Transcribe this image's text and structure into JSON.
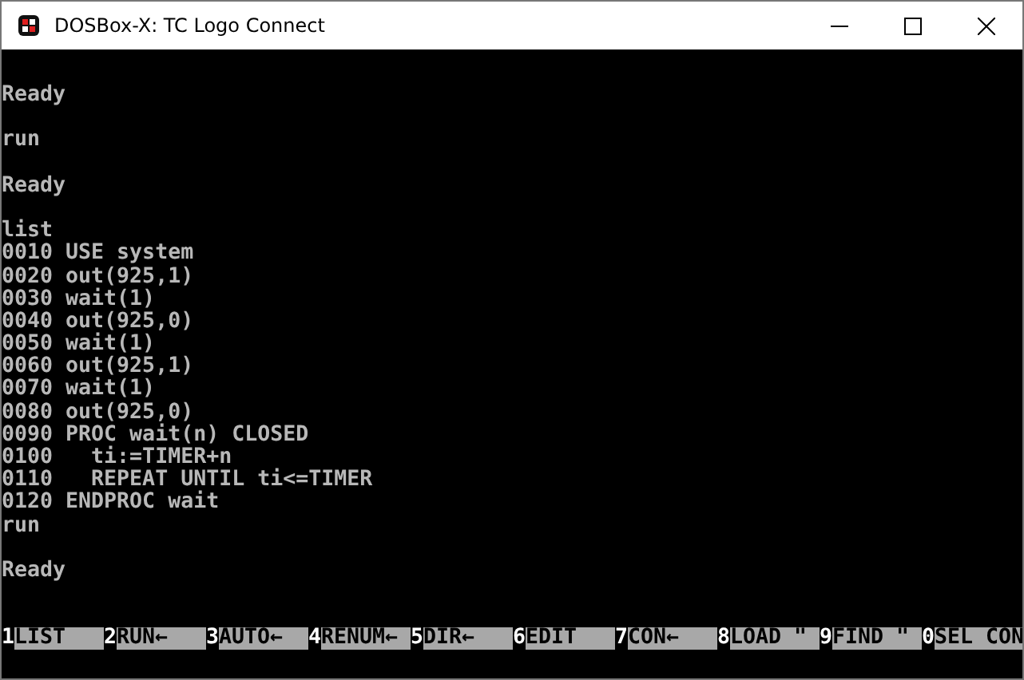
{
  "window": {
    "title": "DOSBox-X: TC Logo Connect"
  },
  "console": {
    "blocks": [
      [
        "Ready"
      ],
      [
        "run"
      ],
      [
        "Ready"
      ],
      [
        "list",
        "0010 USE system",
        "0020 out(925,1)",
        "0030 wait(1)",
        "0040 out(925,0)",
        "0050 wait(1)",
        "0060 out(925,1)",
        "0070 wait(1)",
        "0080 out(925,0)",
        "0090 PROC wait(n) CLOSED",
        "0100   ti:=TIMER+n",
        "0110   REPEAT UNTIL ti<=TIMER",
        "0120 ENDPROC wait",
        "run"
      ],
      [
        "Ready"
      ]
    ]
  },
  "function_keys": [
    {
      "key": "1",
      "label": "LIST"
    },
    {
      "key": "2",
      "label": "RUN←"
    },
    {
      "key": "3",
      "label": "AUTO←"
    },
    {
      "key": "4",
      "label": "RENUM←"
    },
    {
      "key": "5",
      "label": "DIR←"
    },
    {
      "key": "6",
      "label": "EDIT"
    },
    {
      "key": "7",
      "label": "CON←"
    },
    {
      "key": "8",
      "label": "LOAD \""
    },
    {
      "key": "9",
      "label": "FIND \""
    },
    {
      "key": "0",
      "label": "SEL CON"
    }
  ]
}
